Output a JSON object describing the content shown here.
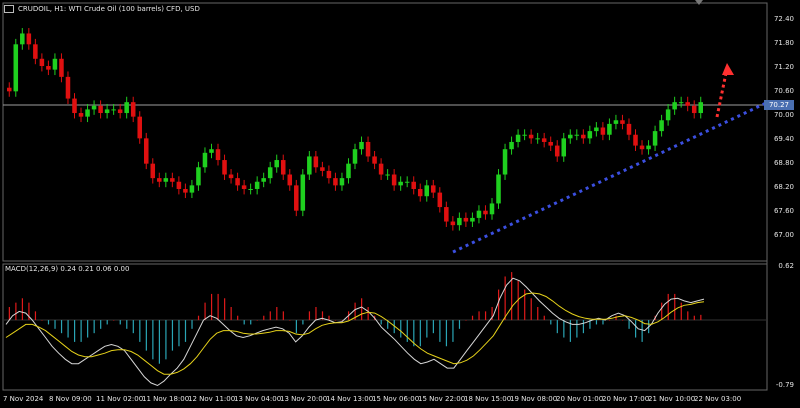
{
  "header": {
    "symbol_title": "CRUDOIL, H1: WTI Crude Oil (100 barrels) CFD, USD"
  },
  "indicator": {
    "title": "MACD(12,26,9) 0.24 0.21 0.06 0.00",
    "scale_top": "0.62",
    "scale_bottom": "-0.79"
  },
  "price_axis": {
    "ticks": [
      "72.40",
      "71.80",
      "71.20",
      "70.60",
      "70.00",
      "69.40",
      "68.80",
      "68.20",
      "67.60",
      "67.00"
    ],
    "current_price": "70.27"
  },
  "time_axis": {
    "ticks": [
      "7 Nov 2024",
      "8 Nov 09:00",
      "11 Nov 02:00",
      "11 Nov 18:00",
      "12 Nov 11:00",
      "13 Nov 04:00",
      "13 Nov 20:00",
      "14 Nov 13:00",
      "15 Nov 06:00",
      "15 Nov 22:00",
      "18 Nov 15:00",
      "19 Nov 08:00",
      "20 Nov 01:00",
      "20 Nov 17:00",
      "21 Nov 10:00",
      "22 Nov 03:00"
    ]
  },
  "colors": {
    "bull": "#1fd01f",
    "bear": "#e01010",
    "trendline": "#3b4fe0",
    "arrow": "#ff3030",
    "macd_main": "#d7d7d7",
    "macd_signal": "#e5d11a",
    "hist_pos": "#e01a1a",
    "hist_neg": "#2aa5b5"
  },
  "chart_data": {
    "type": "candlestick",
    "title": "CRUDOIL, H1: WTI Crude Oil (100 barrels) CFD, USD",
    "ylim": [
      66.6,
      72.6
    ],
    "close_approx": [
      70.6,
      71.9,
      72.2,
      71.9,
      71.5,
      71.3,
      71.2,
      71.5,
      71.0,
      70.4,
      70.0,
      69.9,
      70.1,
      70.2,
      70.0,
      70.1,
      70.1,
      70.0,
      70.3,
      69.9,
      69.3,
      68.6,
      68.2,
      68.1,
      68.2,
      68.1,
      67.9,
      67.8,
      68.0,
      68.5,
      68.9,
      69.0,
      68.7,
      68.3,
      68.2,
      68.0,
      67.9,
      67.9,
      68.1,
      68.2,
      68.5,
      68.7,
      68.3,
      68.0,
      67.3,
      68.3,
      68.8,
      68.5,
      68.4,
      68.2,
      68.0,
      68.2,
      68.6,
      69.0,
      69.2,
      68.8,
      68.6,
      68.3,
      68.3,
      68.0,
      68.1,
      68.1,
      67.9,
      67.7,
      68.0,
      67.8,
      67.4,
      67.0,
      66.9,
      67.1,
      67.0,
      67.1,
      67.3,
      67.2,
      67.5,
      68.3,
      69.0,
      69.2,
      69.4,
      69.4,
      69.3,
      69.3,
      69.2,
      69.1,
      68.8,
      69.3,
      69.4,
      69.4,
      69.3,
      69.5,
      69.6,
      69.4,
      69.7,
      69.8,
      69.7,
      69.4,
      69.1,
      69.0,
      69.1,
      69.5,
      69.8,
      70.1,
      70.3,
      70.3,
      70.2,
      70.0,
      70.3
    ],
    "current_price": 70.27,
    "macd": {
      "label": "MACD(12,26,9) 0.24 0.21 0.06 0.00",
      "ylim": [
        -0.79,
        0.62
      ],
      "histogram": [
        0.15,
        0.2,
        0.25,
        0.2,
        0.1,
        0.0,
        -0.05,
        -0.1,
        -0.15,
        -0.2,
        -0.25,
        -0.25,
        -0.2,
        -0.15,
        -0.1,
        -0.05,
        0.0,
        -0.05,
        -0.1,
        -0.15,
        -0.25,
        -0.35,
        -0.45,
        -0.5,
        -0.45,
        -0.35,
        -0.3,
        -0.25,
        -0.1,
        0.05,
        0.2,
        0.3,
        0.3,
        0.25,
        0.15,
        0.05,
        -0.05,
        -0.05,
        0.0,
        0.05,
        0.1,
        0.15,
        0.1,
        0.0,
        -0.15,
        -0.05,
        0.1,
        0.15,
        0.1,
        0.05,
        0.0,
        0.0,
        0.1,
        0.2,
        0.25,
        0.15,
        0.05,
        -0.05,
        -0.1,
        -0.15,
        -0.2,
        -0.25,
        -0.3,
        -0.3,
        -0.2,
        -0.15,
        -0.25,
        -0.3,
        -0.25,
        -0.1,
        0.0,
        0.05,
        0.1,
        0.1,
        0.15,
        0.35,
        0.5,
        0.55,
        0.45,
        0.35,
        0.25,
        0.15,
        0.05,
        -0.05,
        -0.15,
        -0.2,
        -0.25,
        -0.2,
        -0.15,
        -0.1,
        -0.05,
        -0.05,
        0.0,
        0.05,
        0.0,
        -0.1,
        -0.2,
        -0.25,
        -0.15,
        0.05,
        0.2,
        0.3,
        0.3,
        0.2,
        0.1,
        0.05,
        0.06
      ],
      "macd_line": [
        -0.05,
        0.05,
        0.1,
        0.08,
        0.0,
        -0.1,
        -0.2,
        -0.3,
        -0.38,
        -0.45,
        -0.5,
        -0.5,
        -0.45,
        -0.4,
        -0.35,
        -0.3,
        -0.28,
        -0.3,
        -0.35,
        -0.45,
        -0.55,
        -0.65,
        -0.72,
        -0.75,
        -0.7,
        -0.62,
        -0.55,
        -0.45,
        -0.3,
        -0.15,
        0.0,
        0.05,
        0.02,
        -0.05,
        -0.12,
        -0.18,
        -0.2,
        -0.18,
        -0.15,
        -0.12,
        -0.1,
        -0.08,
        -0.1,
        -0.15,
        -0.25,
        -0.18,
        -0.08,
        0.0,
        0.02,
        0.0,
        -0.03,
        -0.02,
        0.05,
        0.12,
        0.15,
        0.1,
        0.02,
        -0.08,
        -0.15,
        -0.22,
        -0.3,
        -0.38,
        -0.45,
        -0.5,
        -0.48,
        -0.45,
        -0.5,
        -0.55,
        -0.55,
        -0.45,
        -0.35,
        -0.25,
        -0.15,
        -0.05,
        0.05,
        0.25,
        0.4,
        0.48,
        0.45,
        0.38,
        0.3,
        0.22,
        0.15,
        0.08,
        0.02,
        -0.02,
        -0.05,
        -0.05,
        -0.03,
        0.0,
        0.02,
        0.0,
        0.05,
        0.08,
        0.05,
        -0.02,
        -0.1,
        -0.12,
        -0.05,
        0.08,
        0.18,
        0.24,
        0.25,
        0.22,
        0.2,
        0.22,
        0.24
      ],
      "signal_line": [
        -0.2,
        -0.15,
        -0.1,
        -0.05,
        -0.05,
        -0.08,
        -0.12,
        -0.18,
        -0.24,
        -0.3,
        -0.36,
        -0.4,
        -0.42,
        -0.42,
        -0.4,
        -0.38,
        -0.35,
        -0.34,
        -0.34,
        -0.36,
        -0.4,
        -0.46,
        -0.52,
        -0.58,
        -0.62,
        -0.62,
        -0.6,
        -0.56,
        -0.5,
        -0.42,
        -0.32,
        -0.22,
        -0.15,
        -0.12,
        -0.12,
        -0.13,
        -0.15,
        -0.16,
        -0.16,
        -0.15,
        -0.14,
        -0.12,
        -0.12,
        -0.13,
        -0.16,
        -0.17,
        -0.15,
        -0.1,
        -0.06,
        -0.04,
        -0.03,
        -0.03,
        -0.01,
        0.03,
        0.07,
        0.09,
        0.08,
        0.04,
        -0.01,
        -0.07,
        -0.13,
        -0.2,
        -0.27,
        -0.33,
        -0.38,
        -0.41,
        -0.44,
        -0.47,
        -0.5,
        -0.49,
        -0.46,
        -0.41,
        -0.34,
        -0.26,
        -0.18,
        -0.06,
        0.06,
        0.17,
        0.25,
        0.3,
        0.31,
        0.3,
        0.27,
        0.22,
        0.16,
        0.11,
        0.07,
        0.04,
        0.02,
        0.01,
        0.01,
        0.01,
        0.02,
        0.04,
        0.05,
        0.03,
        0.0,
        -0.04,
        -0.05,
        -0.02,
        0.03,
        0.09,
        0.14,
        0.17,
        0.18,
        0.2,
        0.21
      ]
    }
  }
}
